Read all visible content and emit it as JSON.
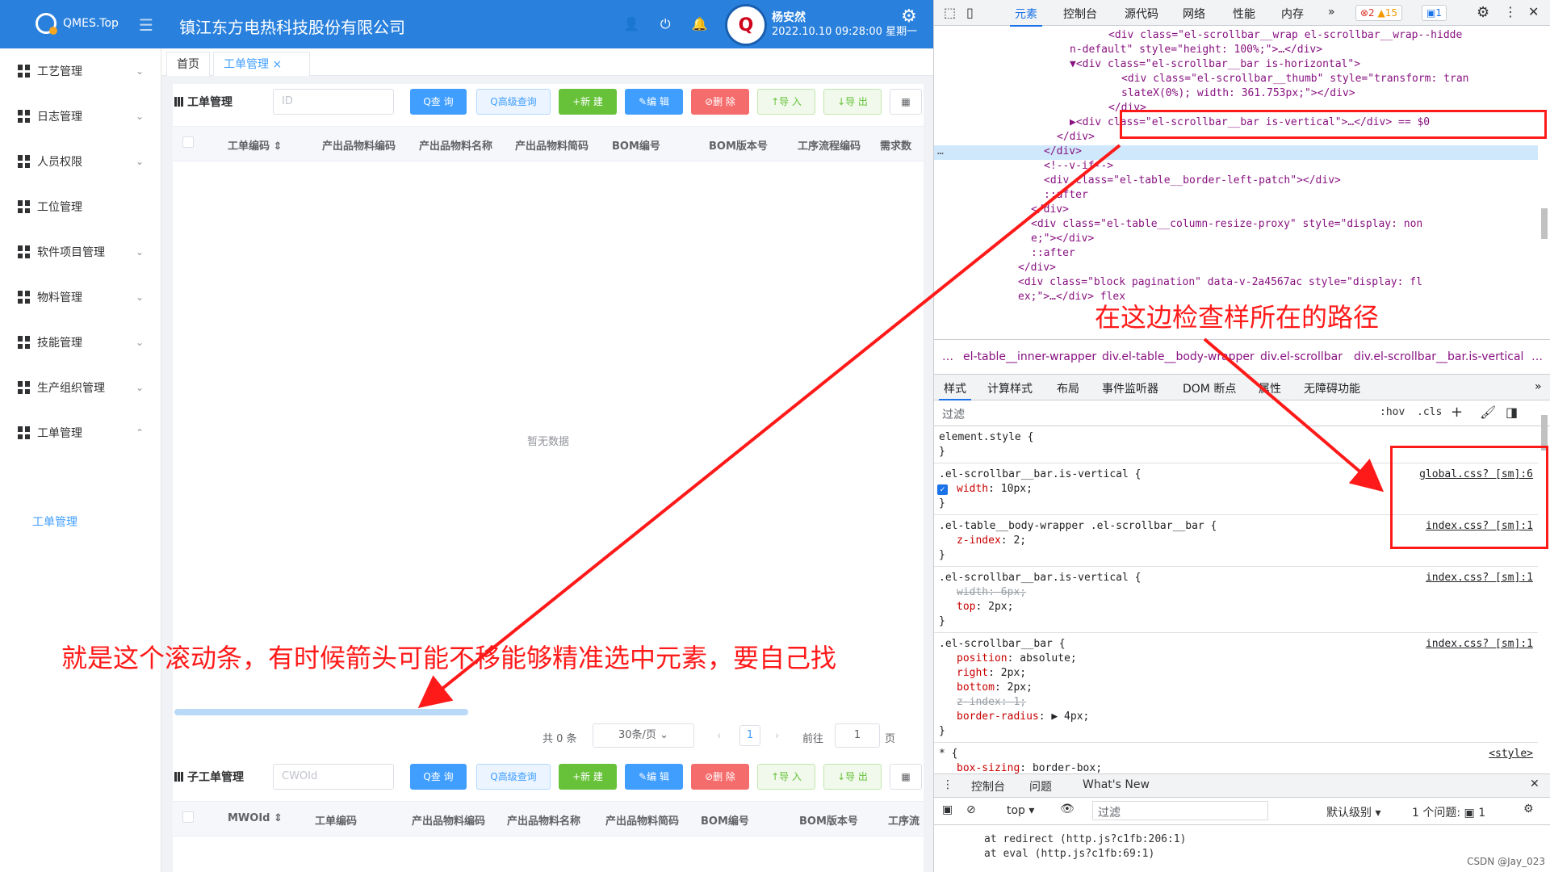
{
  "app": {
    "logo_text": "QMES.Top",
    "company": "镇江东方电热科技股份有限公司",
    "user_name": "杨安然",
    "datetime": "2022.10.10 09:28:00 星期一",
    "avatar_letter": "Q"
  },
  "sidebar": {
    "items": [
      {
        "label": "工艺管理",
        "chevron": "⌄"
      },
      {
        "label": "日志管理",
        "chevron": "⌄"
      },
      {
        "label": "人员权限",
        "chevron": "⌄"
      },
      {
        "label": "工位管理",
        "chevron": ""
      },
      {
        "label": "软件项目管理",
        "chevron": "⌄"
      },
      {
        "label": "物料管理",
        "chevron": "⌄"
      },
      {
        "label": "技能管理",
        "chevron": "⌄"
      },
      {
        "label": "生产组织管理",
        "chevron": "⌄"
      },
      {
        "label": "工单管理",
        "chevron": "⌃"
      }
    ],
    "sub_item": "工单管理"
  },
  "tabs": {
    "home": "首页",
    "active": "工单管理",
    "close": "×"
  },
  "panel1": {
    "title": "工单管理",
    "search_placeholder": "ID",
    "buttons": {
      "query": "Q查 询",
      "adv": "Q高级查询",
      "new": "+新 建",
      "edit": "✎编 辑",
      "delete": "⊘删 除",
      "import": "↑导 入",
      "export": "↓导 出",
      "cols": "▦"
    },
    "columns": [
      "工单编码 ⇕",
      "产出品物料编码",
      "产出品物料名称",
      "产出品物料简码",
      "BOM编号",
      "BOM版本号",
      "工序流程编码",
      "需求数"
    ],
    "empty": "暂无数据",
    "pager": {
      "total": "共 0 条",
      "size": "30条/页",
      "page": "1",
      "goto": "前往",
      "goto_val": "1",
      "page_unit": "页",
      "prev": "‹",
      "next": "›",
      "size_arrow": "⌄"
    }
  },
  "panel2": {
    "title": "子工单管理",
    "search_placeholder": "CWOId",
    "buttons": {
      "query": "Q查 询",
      "adv": "Q高级查询",
      "new": "+新 建",
      "edit": "✎编 辑",
      "delete": "⊘删 除",
      "import": "↑导 入",
      "export": "↓导 出",
      "cols": "▦"
    },
    "columns": [
      "MWOId ⇕",
      "工单编码",
      "产出品物料编码",
      "产出品物料名称",
      "产出品物料简码",
      "BOM编号",
      "BOM版本号",
      "工序流"
    ]
  },
  "annotations": {
    "left": "就是这个滚动条，有时候箭头可能不移能够精准选中元素，要自己找",
    "right": "在这边检查样所在的路径"
  },
  "devtools": {
    "tabs": [
      "元素",
      "控制台",
      "源代码",
      "网络",
      "性能",
      "内存",
      "»"
    ],
    "badges": {
      "errors": "⊗2",
      "warnings": "▲15",
      "messages": "▣1"
    },
    "code_lines": [
      {
        "ind": 27,
        "html": "<div class=\"el-scrollbar__wrap el-scrollbar__wrap--hidde"
      },
      {
        "ind": 21,
        "html": "n-default\" style=\"height: 100%;\">…</div>"
      },
      {
        "ind": 21,
        "html": "▼<div class=\"el-scrollbar__bar is-horizontal\">"
      },
      {
        "ind": 29,
        "html": "<div class=\"el-scrollbar__thumb\" style=\"transform: tran"
      },
      {
        "ind": 29,
        "html": "slateX(0%); width: 361.753px;\"></div>"
      },
      {
        "ind": 27,
        "html": "</div>"
      },
      {
        "ind": 21,
        "html": "▶<div class=\"el-scrollbar__bar is-vertical\">…</div> == $0"
      },
      {
        "ind": 19,
        "html": "</div>"
      },
      {
        "ind": 17,
        "html": "</div>"
      },
      {
        "ind": 17,
        "html": "<!--v-if-->"
      },
      {
        "ind": 17,
        "html": "<div class=\"el-table__border-left-patch\"></div>"
      },
      {
        "ind": 17,
        "html": "::after"
      },
      {
        "ind": 15,
        "html": "</div>"
      },
      {
        "ind": 15,
        "html": "<div class=\"el-table__column-resize-proxy\" style=\"display: non"
      },
      {
        "ind": 15,
        "html": "e;\"></div>"
      },
      {
        "ind": 15,
        "html": "::after"
      },
      {
        "ind": 13,
        "html": "</div>"
      },
      {
        "ind": 13,
        "html": "<div class=\"block pagination\" data-v-2a4567ac style=\"display: fl"
      },
      {
        "ind": 13,
        "html": "ex;\">…</div> flex"
      }
    ],
    "crumbs": [
      "…",
      "el-table__inner-wrapper",
      "div.el-table__body-wrapper",
      "div.el-scrollbar",
      "div.el-scrollbar__bar.is-vertical",
      "…"
    ],
    "style_tabs": [
      "样式",
      "计算样式",
      "布局",
      "事件监听器",
      "DOM 断点",
      "属性",
      "无障碍功能",
      "»"
    ],
    "filter_placeholder": "过滤",
    "filter_tools": [
      ":hov",
      ".cls",
      "+"
    ],
    "rules": [
      {
        "selector": "element.style {",
        "source": "",
        "props": [],
        "close": "}"
      },
      {
        "selector": ".el-scrollbar__bar.is-vertical {",
        "source": "global.css? [sm]:6",
        "props": [
          {
            "n": "width",
            "v": "10px;",
            "strike": false,
            "checked": true
          }
        ],
        "close": "}"
      },
      {
        "selector": ".el-table__body-wrapper .el-scrollbar__bar {",
        "source": "index.css? [sm]:1",
        "props": [
          {
            "n": "z-index",
            "v": "2;",
            "strike": false
          }
        ],
        "close": "}"
      },
      {
        "selector": ".el-scrollbar__bar.is-vertical {",
        "source": "index.css? [sm]:1",
        "props": [
          {
            "n": "width",
            "v": "6px;",
            "strike": true
          },
          {
            "n": "top",
            "v": "2px;",
            "strike": false
          }
        ],
        "close": "}"
      },
      {
        "selector": ".el-scrollbar__bar {",
        "source": "index.css? [sm]:1",
        "props": [
          {
            "n": "position",
            "v": "absolute;",
            "strike": false
          },
          {
            "n": "right",
            "v": "2px;",
            "strike": false
          },
          {
            "n": "bottom",
            "v": "2px;",
            "strike": false
          },
          {
            "n": "z-index",
            "v": "1;",
            "strike": true
          },
          {
            "n": "border-radius",
            "v": "▶ 4px;",
            "strike": false
          }
        ],
        "close": "}"
      },
      {
        "selector": "* {",
        "source": "<style>",
        "props": [
          {
            "n": "box-sizing",
            "v": "border-box;",
            "strike": false
          }
        ],
        "close": ""
      }
    ],
    "console": {
      "tabs": [
        "控制台",
        "问题",
        "What's New"
      ],
      "context": "top ▾",
      "filter": "过滤",
      "level": "默认级别 ▾",
      "issues": "1 个问题: ▣ 1",
      "lines": [
        "at redirect (http.js?c1fb:206:1)",
        "at eval (http.js?c1fb:69:1)"
      ]
    },
    "watermark": "CSDN @Jay_023"
  }
}
